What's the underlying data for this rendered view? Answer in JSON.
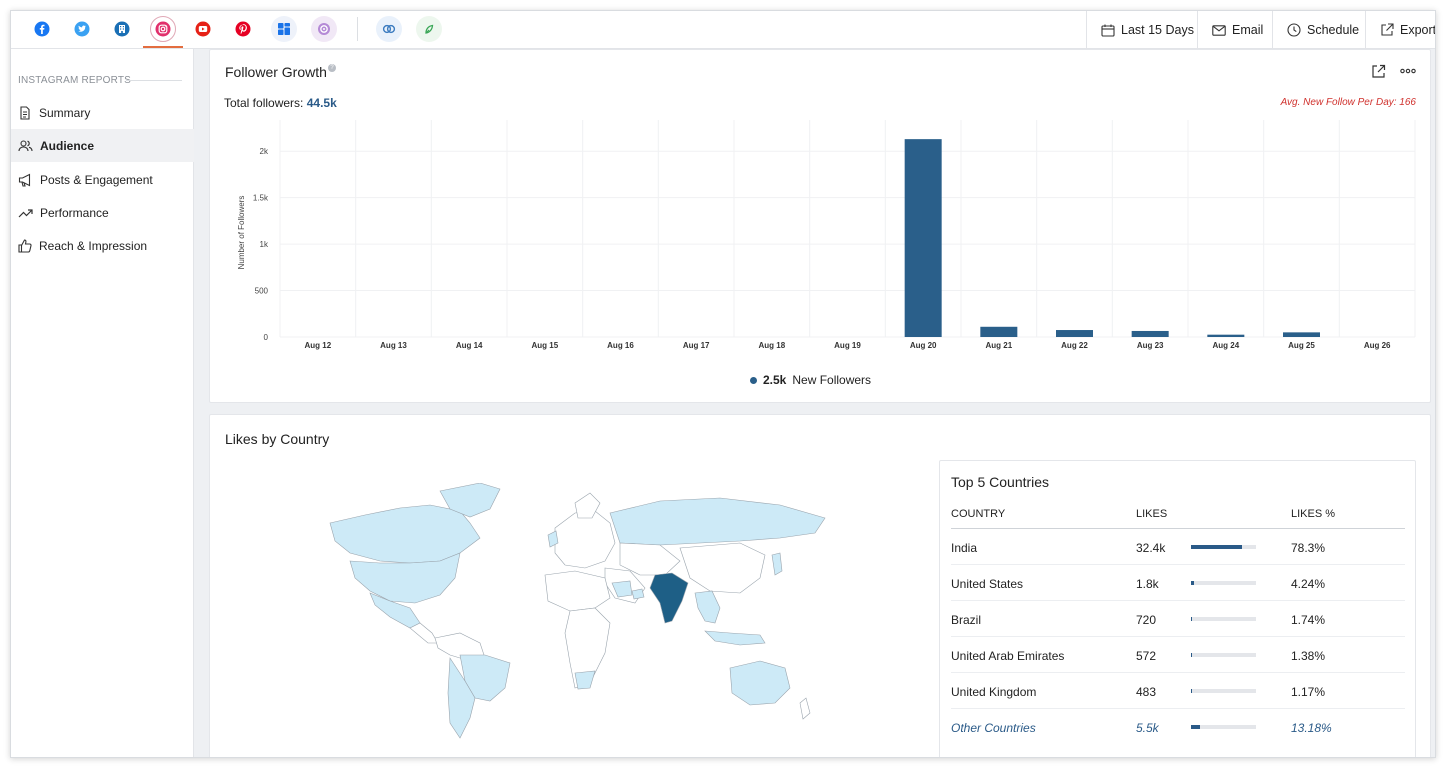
{
  "topbar": {
    "networks": [
      {
        "name": "facebook",
        "icon": "facebook-icon",
        "color": "#1877f2"
      },
      {
        "name": "twitter",
        "icon": "twitter-icon",
        "color": "#1da1f2"
      },
      {
        "name": "google-business",
        "icon": "building-icon",
        "color": "#1a6fb5"
      },
      {
        "name": "instagram",
        "icon": "instagram-icon",
        "color": "#e1306c",
        "active": true
      },
      {
        "name": "youtube",
        "icon": "youtube-icon",
        "color": "#ff0000"
      },
      {
        "name": "pinterest",
        "icon": "pinterest-icon",
        "color": "#e60023"
      },
      {
        "name": "google-my-business",
        "icon": "grid-icon",
        "color": "#1a73e8"
      },
      {
        "name": "threads",
        "icon": "threads-icon",
        "color": "#9b59b6"
      },
      {
        "name": "linked-profiles",
        "icon": "link-rings-icon",
        "color": "#3b7bbf"
      },
      {
        "name": "app",
        "icon": "leaf-icon",
        "color": "#3aa757"
      }
    ],
    "actions": {
      "date_range": "Last 15 Days",
      "email": "Email",
      "schedule": "Schedule",
      "export": "Export"
    }
  },
  "sidebar": {
    "heading": "INSTAGRAM REPORTS",
    "items": [
      {
        "label": "Summary",
        "icon": "document-icon"
      },
      {
        "label": "Audience",
        "icon": "users-icon",
        "active": true
      },
      {
        "label": "Posts & Engagement",
        "icon": "megaphone-icon"
      },
      {
        "label": "Performance",
        "icon": "trend-icon"
      },
      {
        "label": "Reach & Impression",
        "icon": "thumbs-up-icon"
      }
    ]
  },
  "follower_growth": {
    "title": "Follower Growth",
    "total_label": "Total followers:",
    "total_value": "44.5k",
    "avg_text": "Avg. New Follow Per Day: 166",
    "legend_value": "2.5k",
    "legend_label": "New Followers",
    "accent": "#2a5f8a"
  },
  "chart_data": {
    "type": "bar",
    "categories": [
      "Aug 12",
      "Aug 13",
      "Aug 14",
      "Aug 15",
      "Aug 16",
      "Aug 17",
      "Aug 18",
      "Aug 19",
      "Aug 20",
      "Aug 21",
      "Aug 22",
      "Aug 23",
      "Aug 24",
      "Aug 25",
      "Aug 26"
    ],
    "series": [
      {
        "name": "New Followers",
        "values": [
          0,
          0,
          0,
          0,
          0,
          0,
          0,
          0,
          2130,
          110,
          75,
          65,
          25,
          50,
          0
        ],
        "color": "#2a5f8a"
      }
    ],
    "ylabel": "Number of Followers",
    "yticks": [
      0,
      500,
      1000,
      1500,
      2000
    ],
    "ytick_labels": [
      "0",
      "500",
      "1k",
      "1.5k",
      "2k"
    ],
    "ylim": [
      0,
      2250
    ],
    "grid": true,
    "legend": "bottom-center"
  },
  "likes_by_country": {
    "title": "Likes by Country",
    "top5_title": "Top 5 Countries",
    "columns": [
      "COUNTRY",
      "LIKES",
      "LIKES %"
    ],
    "rows": [
      {
        "country": "India",
        "likes": "32.4k",
        "pct": "78.3%",
        "share": 0.783
      },
      {
        "country": "United States",
        "likes": "1.8k",
        "pct": "4.24%",
        "share": 0.0424
      },
      {
        "country": "Brazil",
        "likes": "720",
        "pct": "1.74%",
        "share": 0.0174
      },
      {
        "country": "United Arab Emirates",
        "likes": "572",
        "pct": "1.38%",
        "share": 0.0138
      },
      {
        "country": "United Kingdom",
        "likes": "483",
        "pct": "1.17%",
        "share": 0.0117
      },
      {
        "country": "Other Countries",
        "likes": "5.5k",
        "pct": "13.18%",
        "share": 0.1318,
        "other": true
      }
    ],
    "map_colors": {
      "highlight": "#1e5f86",
      "light": "#cdeaf7",
      "base": "#ffffff",
      "border": "#9aa4ad"
    }
  }
}
